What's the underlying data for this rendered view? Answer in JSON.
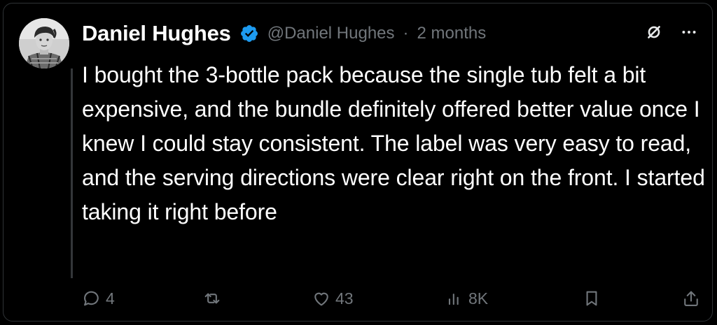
{
  "post": {
    "author_name": "Daniel Hughes",
    "handle": "@Daniel Hughes",
    "separator": "·",
    "timestamp": "2 months",
    "text": "I bought the 3-bottle pack because the single tub felt a bit expensive, and the bundle definitely offered better value once I knew I could stay consistent. The label was very easy to read, and the serving directions were clear right on the front. I started taking it right before"
  },
  "header_icons": [
    "slashed-circle-icon",
    "more-icon"
  ],
  "actions": {
    "reply_count": "4",
    "repost_count": "",
    "like_count": "43",
    "views_count": "8K"
  },
  "colors": {
    "background": "#000000",
    "text": "#ffffff",
    "muted": "#71767b",
    "verified": "#1d9bf0",
    "border": "#2f3336"
  }
}
